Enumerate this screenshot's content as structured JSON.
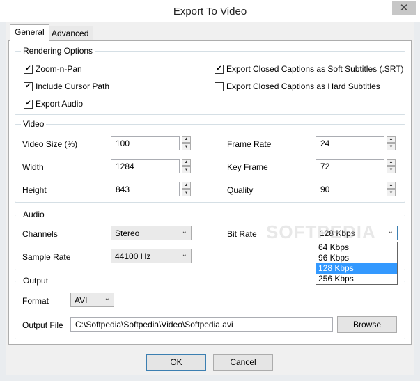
{
  "window": {
    "title": "Export To Video",
    "close_glyph": "✕"
  },
  "tabs": [
    {
      "label": "General"
    },
    {
      "label": "Advanced"
    }
  ],
  "rendering": {
    "title": "Rendering Options",
    "zoom_n_pan": {
      "label": "Zoom-n-Pan",
      "checked": true
    },
    "include_cursor": {
      "label": "Include Cursor Path",
      "checked": true
    },
    "export_audio": {
      "label": "Export Audio",
      "checked": true
    },
    "soft_subtitles": {
      "label": "Export Closed Captions as Soft Subtitles (.SRT)",
      "checked": true
    },
    "hard_subtitles": {
      "label": "Export Closed Captions as Hard Subtitles",
      "checked": false
    }
  },
  "video": {
    "title": "Video",
    "video_size": {
      "label": "Video Size (%)",
      "value": "100"
    },
    "width": {
      "label": "Width",
      "value": "1284"
    },
    "height": {
      "label": "Height",
      "value": "843"
    },
    "frame_rate": {
      "label": "Frame Rate",
      "value": "24"
    },
    "key_frame": {
      "label": "Key Frame",
      "value": "72"
    },
    "quality": {
      "label": "Quality",
      "value": "90"
    }
  },
  "audio": {
    "title": "Audio",
    "channels": {
      "label": "Channels",
      "value": "Stereo"
    },
    "sample_rate": {
      "label": "Sample Rate",
      "value": "44100 Hz"
    },
    "bit_rate": {
      "label": "Bit Rate",
      "value": "128 Kbps",
      "options": [
        "64 Kbps",
        "96 Kbps",
        "128 Kbps",
        "256 Kbps"
      ],
      "selected_index": 2
    }
  },
  "output": {
    "title": "Output",
    "format": {
      "label": "Format",
      "value": "AVI"
    },
    "file": {
      "label": "Output File",
      "value": "C:\\Softpedia\\Softpedia\\Video\\Softpedia.avi"
    },
    "browse_label": "Browse"
  },
  "buttons": {
    "ok": "OK",
    "cancel": "Cancel"
  },
  "watermark": "SOFTPEDIA",
  "icons": {
    "check": "check-icon",
    "arrow": "chevron-down-icon",
    "spin_up": "triangle-up-icon",
    "spin_down": "triangle-down-icon"
  }
}
